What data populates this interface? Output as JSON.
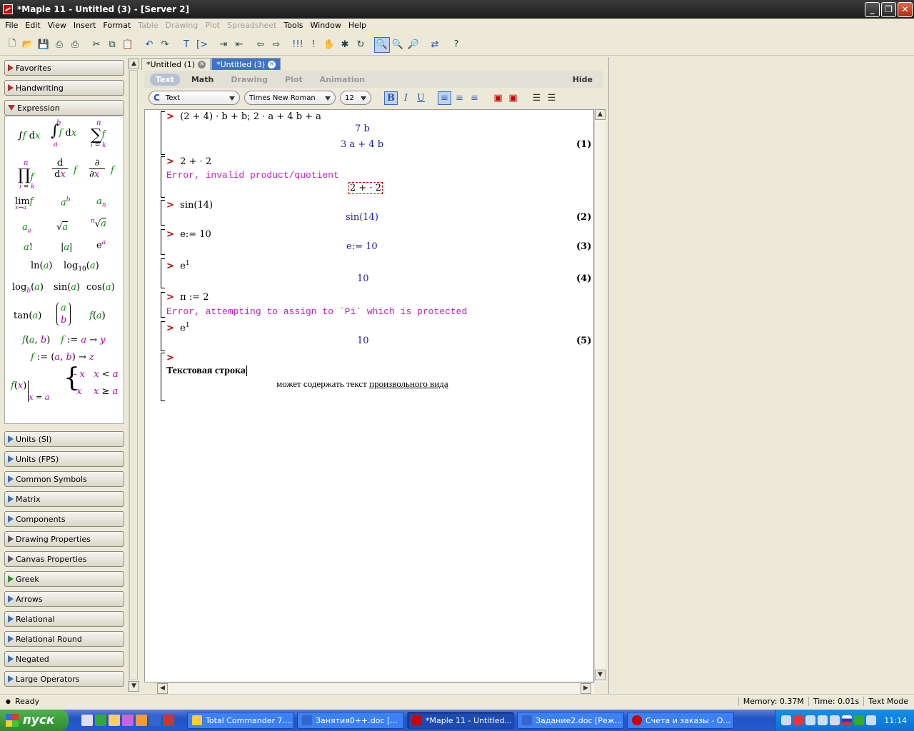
{
  "window": {
    "title": "*Maple 11 - Untitled (3) - [Server 2]"
  },
  "menu": [
    {
      "label": "File",
      "enabled": true
    },
    {
      "label": "Edit",
      "enabled": true
    },
    {
      "label": "View",
      "enabled": true
    },
    {
      "label": "Insert",
      "enabled": true
    },
    {
      "label": "Format",
      "enabled": true
    },
    {
      "label": "Table",
      "enabled": false
    },
    {
      "label": "Drawing",
      "enabled": false
    },
    {
      "label": "Plot",
      "enabled": false
    },
    {
      "label": "Spreadsheet",
      "enabled": false
    },
    {
      "label": "Tools",
      "enabled": true
    },
    {
      "label": "Window",
      "enabled": true
    },
    {
      "label": "Help",
      "enabled": true
    }
  ],
  "palettes": {
    "top": [
      "Favorites",
      "Handwriting"
    ],
    "expression": "Expression",
    "bottom": [
      "Units (SI)",
      "Units (FPS)",
      "Common Symbols",
      "Matrix",
      "Components",
      "Drawing Properties",
      "Canvas Properties",
      "Greek",
      "Arrows",
      "Relational",
      "Relational Round",
      "Negated",
      "Large Operators"
    ]
  },
  "doc_tabs": [
    {
      "label": "*Untitled (1)",
      "active": false
    },
    {
      "label": "*Untitled (3)",
      "active": true
    }
  ],
  "context_bar": {
    "items": [
      "Text",
      "Math",
      "Drawing",
      "Plot",
      "Animation"
    ],
    "active": "Text",
    "hide": "Hide"
  },
  "format_bar": {
    "style": "Text",
    "style_prefix": "C",
    "font": "Times New Roman",
    "size": "12"
  },
  "worksheet": {
    "in1": "(2 + 4) · b + b; 2 · a + 4 b + a",
    "out1a": "7 b",
    "out1b": "3 a + 4 b",
    "lbl1": "(1)",
    "in2": "2 + · 2",
    "err1": "Error, invalid product/quotient",
    "errexpr": "2 + · 2",
    "in3": "sin(14)",
    "out3": "sin(14)",
    "lbl2": "(2)",
    "in4": "e:= 10",
    "out4": "e:= 10",
    "lbl3": "(3)",
    "in5": "e",
    "in5sup": "1",
    "out5": "10",
    "lbl4": "(4)",
    "in6": "π := 2",
    "err2": "Error, attempting to assign to `Pi` which is protected",
    "in7": "e",
    "in7sup": "1",
    "out7": "10",
    "lbl5": "(5)",
    "text1": "Текстовая строка",
    "text2a": "может содержать текст ",
    "text2b": "произвольного вида"
  },
  "status": {
    "left": "Ready",
    "memory": "Memory: 0.37M",
    "time": "Time: 0.01s",
    "mode": "Text Mode"
  },
  "taskbar": {
    "start": "пуск",
    "tasks": [
      "Total Commander 7....",
      "Занятия0++.doc [...",
      "*Maple 11 - Untitled...",
      "Задание2.doc [Реж...",
      "Счета и заказы - О..."
    ],
    "active_task": 2,
    "clock": "11:14"
  }
}
